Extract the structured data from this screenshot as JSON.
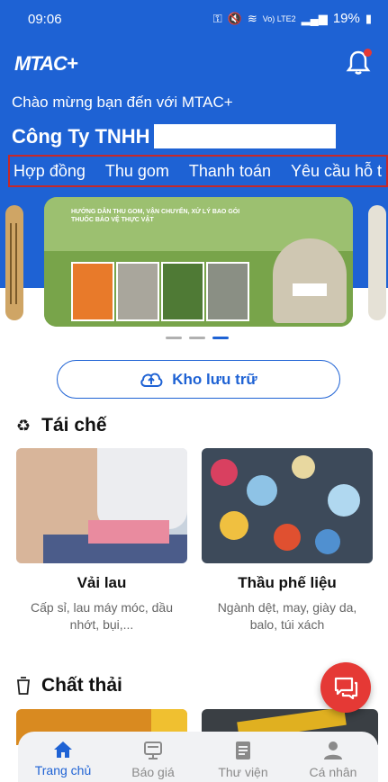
{
  "status_bar": {
    "time": "09:06",
    "network": "Vo) LTE2",
    "battery": "19%"
  },
  "header": {
    "logo": "MTAC+",
    "bell_icon": "bell-icon"
  },
  "greeting": {
    "welcome": "Chào mừng bạn đến với MTAC+",
    "company": "Công Ty TNHH"
  },
  "tabs": [
    "Hợp đồng",
    "Thu gom",
    "Thanh toán",
    "Yêu cầu hỗ t"
  ],
  "banner": {
    "title": "HƯỚNG DẪN THU GOM, VẬN CHUYỂN, XỬ LÝ BAO GÓI THUỐC BẢO VỆ THỰC VẬT",
    "pages": 3,
    "active_page": 3
  },
  "storage_button": {
    "label": "Kho lưu trữ",
    "icon": "cloud-upload-icon"
  },
  "recycle_section": {
    "title": "Tái chế",
    "icon": "recycle-icon",
    "cards": [
      {
        "name": "Vải lau",
        "desc_line1": "Cấp sỉ, lau máy móc, dầu",
        "desc_line2": "nhớt, bụi,..."
      },
      {
        "name": "Thầu phế liệu",
        "desc_line1": "Ngành dệt, may, giày da,",
        "desc_line2": "balo, túi xách"
      }
    ]
  },
  "waste_section": {
    "title": "Chất thải",
    "icon": "trash-bin-icon"
  },
  "fab": {
    "icon": "chat-icon"
  },
  "bottom_nav": [
    {
      "label": "Trang chủ",
      "icon": "home-icon",
      "active": true
    },
    {
      "label": "Báo giá",
      "icon": "quote-board-icon",
      "active": false
    },
    {
      "label": "Thư viện",
      "icon": "library-icon",
      "active": false
    },
    {
      "label": "Cá nhân",
      "icon": "person-icon",
      "active": false
    }
  ],
  "colors": {
    "primary": "#1e62d4",
    "accent": "#e53935",
    "tab_border": "#c62828"
  }
}
